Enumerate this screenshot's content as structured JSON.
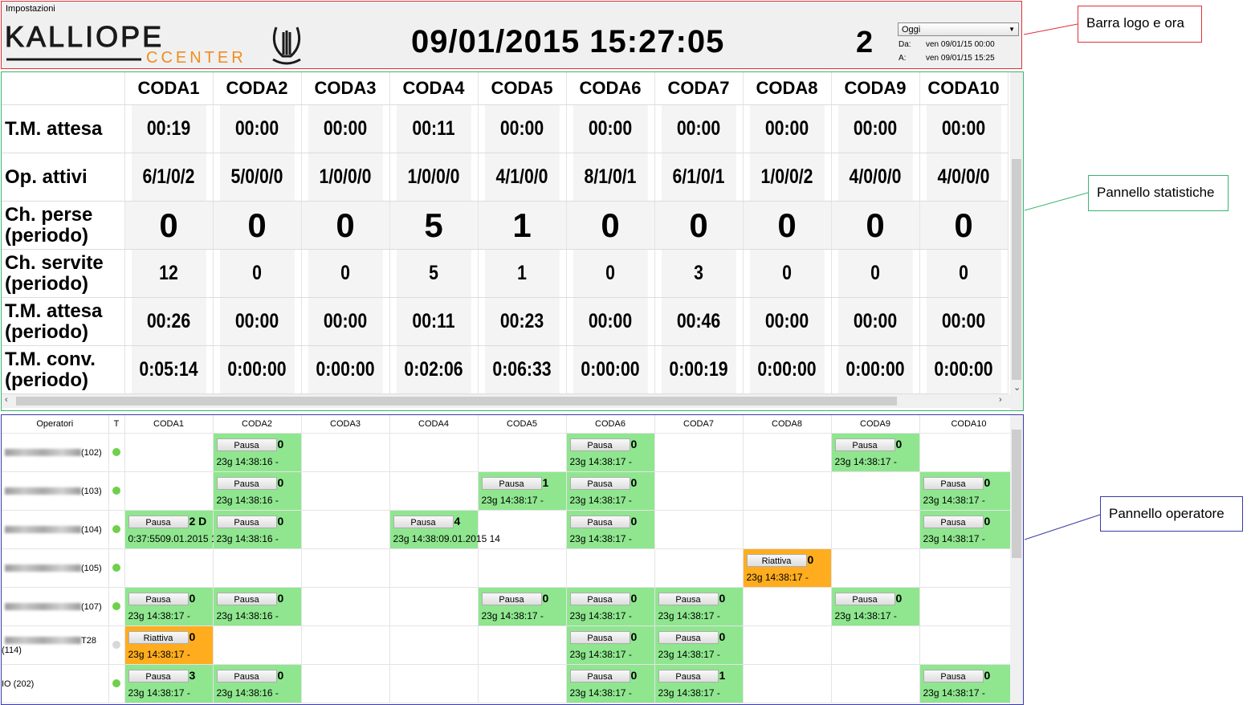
{
  "header": {
    "settings_label": "Impostazioni",
    "logo_text_main": "KALLIOPE",
    "logo_text_sub": "CCENTER",
    "clock": "09/01/2015 15:27:05",
    "counter": "2",
    "period": {
      "selected": "Oggi",
      "from_label": "Da:",
      "from_value": "ven 09/01/15 00:00",
      "to_label": "A:",
      "to_value": "ven 09/01/15 15:25"
    }
  },
  "stats": {
    "queues": [
      "CODA1",
      "CODA2",
      "CODA3",
      "CODA4",
      "CODA5",
      "CODA6",
      "CODA7",
      "CODA8",
      "CODA9",
      "CODA10"
    ],
    "rows": [
      {
        "label": [
          "T.M. attesa"
        ],
        "style": "num",
        "values": [
          "00:19",
          "00:00",
          "00:00",
          "00:11",
          "00:00",
          "00:00",
          "00:00",
          "00:00",
          "00:00",
          "00:00"
        ]
      },
      {
        "label": [
          "Op. attivi"
        ],
        "style": "num",
        "values": [
          "6/1/0/2",
          "5/0/0/0",
          "1/0/0/0",
          "1/0/0/0",
          "4/1/0/0",
          "8/1/0/1",
          "6/1/0/1",
          "1/0/0/2",
          "4/0/0/0",
          "4/0/0/0"
        ]
      },
      {
        "label": [
          "Ch. perse",
          "(periodo)"
        ],
        "style": "big",
        "values": [
          "0",
          "0",
          "0",
          "5",
          "1",
          "0",
          "0",
          "0",
          "0",
          "0"
        ]
      },
      {
        "label": [
          "Ch. servite",
          "(periodo)"
        ],
        "style": "num",
        "values": [
          "12",
          "0",
          "0",
          "5",
          "1",
          "0",
          "3",
          "0",
          "0",
          "0"
        ]
      },
      {
        "label": [
          "T.M. attesa",
          "(periodo)"
        ],
        "style": "num",
        "values": [
          "00:26",
          "00:00",
          "00:00",
          "00:11",
          "00:23",
          "00:00",
          "00:46",
          "00:00",
          "00:00",
          "00:00"
        ]
      },
      {
        "label": [
          "T.M. conv.",
          "(periodo)"
        ],
        "style": "num",
        "values": [
          "0:05:14",
          "0:00:00",
          "0:00:00",
          "0:02:06",
          "0:06:33",
          "0:00:00",
          "0:00:19",
          "0:00:00",
          "0:00:00",
          "0:00:00"
        ]
      }
    ]
  },
  "operators": {
    "col_operators": "Operatori",
    "col_t": "T",
    "queues": [
      "CODA1",
      "CODA2",
      "CODA3",
      "CODA4",
      "CODA5",
      "CODA6",
      "CODA7",
      "CODA8",
      "CODA9",
      "CODA10"
    ],
    "rows": [
      {
        "name": "(102)",
        "online": true,
        "cells": [
          null,
          {
            "color": "green",
            "btn": "Pausa",
            "count": "0",
            "time": "23g 14:38:16  -"
          },
          null,
          null,
          null,
          {
            "color": "green",
            "btn": "Pausa",
            "count": "0",
            "time": "23g 14:38:17  -"
          },
          null,
          null,
          {
            "color": "green",
            "btn": "Pausa",
            "count": "0",
            "time": "23g 14:38:17  -"
          },
          null
        ]
      },
      {
        "name": "(103)",
        "online": true,
        "cells": [
          null,
          {
            "color": "green",
            "btn": "Pausa",
            "count": "0",
            "time": "23g 14:38:16  -"
          },
          null,
          null,
          {
            "color": "green",
            "btn": "Pausa",
            "count": "1",
            "time": "23g 14:38:17  -"
          },
          {
            "color": "green",
            "btn": "Pausa",
            "count": "0",
            "time": "23g 14:38:17  -"
          },
          null,
          null,
          null,
          {
            "color": "green",
            "btn": "Pausa",
            "count": "0",
            "time": "23g 14:38:17  -"
          }
        ]
      },
      {
        "name": "(104)",
        "online": true,
        "cells": [
          {
            "color": "green",
            "btn": "Pausa",
            "count": "2 D",
            "time": "0:37:5509.01.2015 14:"
          },
          {
            "color": "green",
            "btn": "Pausa",
            "count": "0",
            "time": "23g 14:38:16  -"
          },
          null,
          {
            "color": "green",
            "btn": "Pausa",
            "count": "4",
            "time": "23g 14:38:09.01.2015 14"
          },
          null,
          {
            "color": "green",
            "btn": "Pausa",
            "count": "0",
            "time": "23g 14:38:17  -"
          },
          null,
          null,
          null,
          {
            "color": "green",
            "btn": "Pausa",
            "count": "0",
            "time": "23g 14:38:17  -"
          }
        ]
      },
      {
        "name": "(105)",
        "online": true,
        "cells": [
          null,
          null,
          null,
          null,
          null,
          null,
          null,
          {
            "color": "orange",
            "btn": "Riattiva",
            "count": "0",
            "time": "23g 14:38:17  -"
          },
          null,
          null
        ]
      },
      {
        "name": "(107)",
        "online": true,
        "cells": [
          {
            "color": "green",
            "btn": "Pausa",
            "count": "0",
            "time": "23g 14:38:17  -"
          },
          {
            "color": "green",
            "btn": "Pausa",
            "count": "0",
            "time": "23g 14:38:16  -"
          },
          null,
          null,
          {
            "color": "green",
            "btn": "Pausa",
            "count": "0",
            "time": "23g 14:38:17  -"
          },
          {
            "color": "green",
            "btn": "Pausa",
            "count": "0",
            "time": "23g 14:38:17  -"
          },
          {
            "color": "green",
            "btn": "Pausa",
            "count": "0",
            "time": "23g 14:38:17  -"
          },
          null,
          {
            "color": "green",
            "btn": "Pausa",
            "count": "0",
            "time": "23g 14:38:17  -"
          },
          null
        ]
      },
      {
        "name": "T28 (114)",
        "online": false,
        "cells": [
          {
            "color": "orange",
            "btn": "Riattiva",
            "count": "0",
            "time": "23g 14:38:17  -"
          },
          null,
          null,
          null,
          null,
          {
            "color": "green",
            "btn": "Pausa",
            "count": "0",
            "time": "23g 14:38:17  -"
          },
          {
            "color": "green",
            "btn": "Pausa",
            "count": "0",
            "time": "23g 14:38:17  -"
          },
          null,
          null,
          null
        ]
      },
      {
        "name": "IO (202)",
        "online": true,
        "cells": [
          {
            "color": "green",
            "btn": "Pausa",
            "count": "3",
            "time": "23g 14:38:17  -"
          },
          {
            "color": "green",
            "btn": "Pausa",
            "count": "0",
            "time": "23g 14:38:16  -"
          },
          null,
          null,
          null,
          {
            "color": "green",
            "btn": "Pausa",
            "count": "0",
            "time": "23g 14:38:17  -"
          },
          {
            "color": "green",
            "btn": "Pausa",
            "count": "1",
            "time": "23g 14:38:17  -"
          },
          null,
          null,
          {
            "color": "green",
            "btn": "Pausa",
            "count": "0",
            "time": "23g 14:38:17  -"
          }
        ]
      }
    ]
  },
  "callouts": {
    "logo_bar": "Barra logo e ora",
    "stats_panel": "Pannello statistiche",
    "operator_panel": "Pannello operatore"
  },
  "colors": {
    "logo_border": "#e0303a",
    "stats_border": "#3cb46e",
    "ops_border": "#3a3aa8",
    "active": "#8fe68f",
    "paused": "#ffad1f",
    "online_dot": "#6fd04a"
  }
}
